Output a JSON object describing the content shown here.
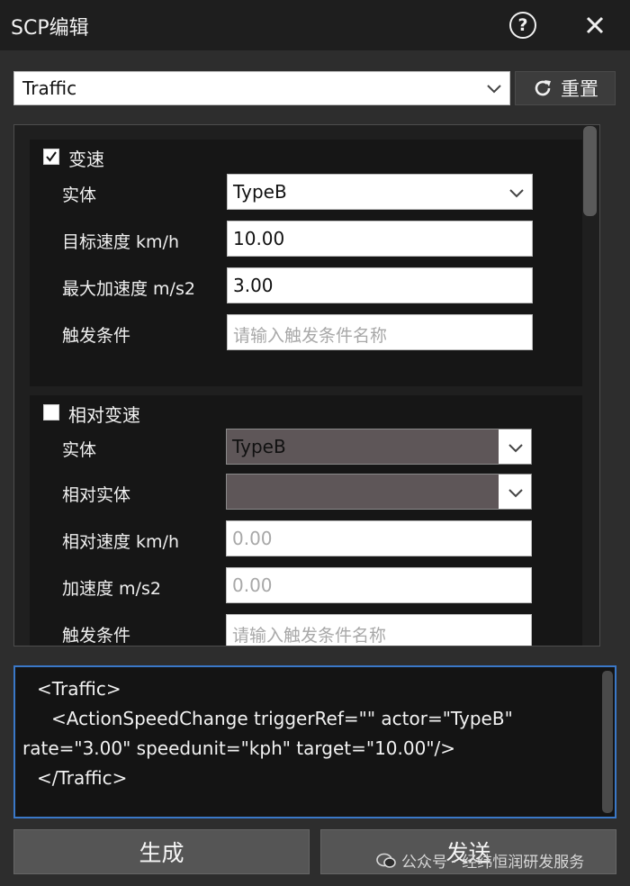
{
  "window": {
    "title": "SCP编辑"
  },
  "header": {
    "selected_type": "Traffic",
    "reset_label": "重置"
  },
  "speed_change": {
    "title": "变速",
    "checked": true,
    "entity_label": "实体",
    "entity_value": "TypeB",
    "target_speed_label": "目标速度 km/h",
    "target_speed_value": "10.00",
    "max_accel_label": "最大加速度 m/s2",
    "max_accel_value": "3.00",
    "trigger_label": "触发条件",
    "trigger_placeholder": "请输入触发条件名称"
  },
  "relative_speed_change": {
    "title": "相对变速",
    "checked": false,
    "entity_label": "实体",
    "entity_value": "TypeB",
    "relative_entity_label": "相对实体",
    "relative_entity_value": "",
    "relative_speed_label": "相对速度 km/h",
    "relative_speed_value": "0.00",
    "accel_label": "加速度 m/s2",
    "accel_value": "0.00",
    "trigger_label": "触发条件",
    "trigger_placeholder": "请输入触发条件名称"
  },
  "xml_output": {
    "lines": [
      "<Traffic>",
      "<ActionSpeedChange triggerRef=\"\" actor=\"TypeB\"",
      "rate=\"3.00\" speedunit=\"kph\" target=\"10.00\"/>",
      "</Traffic>"
    ]
  },
  "footer": {
    "generate_label": "生成",
    "send_label": "发送",
    "watermark": "公众号 · 经纬恒润研发服务"
  },
  "colors": {
    "accent_border": "#3a78c8",
    "panel_bg": "#161616",
    "button_bg": "#555555"
  }
}
